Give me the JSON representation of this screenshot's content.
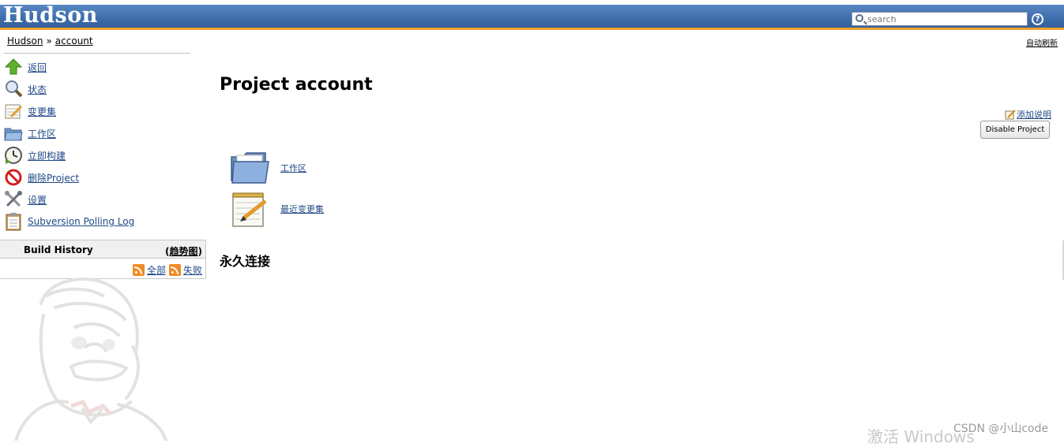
{
  "header": {
    "logo": "Hudson",
    "search_placeholder": "search",
    "help_icon": "?"
  },
  "breadcrumb": {
    "root": "Hudson",
    "separator": "»",
    "current": "account",
    "auto_refresh": "自动刷新"
  },
  "sidebar": {
    "tasks": [
      {
        "label": "返回",
        "icon": "up-arrow-icon"
      },
      {
        "label": "状态",
        "icon": "magnifier-icon"
      },
      {
        "label": "变更集",
        "icon": "notepad-icon"
      },
      {
        "label": "工作区",
        "icon": "folder-icon"
      },
      {
        "label": "立即构建",
        "icon": "clock-icon"
      },
      {
        "label": "删除Project",
        "icon": "no-entry-icon"
      },
      {
        "label": "设置",
        "icon": "tools-icon"
      },
      {
        "label": "Subversion Polling Log",
        "icon": "clipboard-icon"
      }
    ]
  },
  "build_history": {
    "title": "Build History",
    "trend_open": "(",
    "trend": "趋势图",
    "trend_close": ")",
    "feed_all": "全部",
    "feed_failed": "失败"
  },
  "main": {
    "title": "Project account",
    "add_description": "添加说明",
    "disable_button": "Disable Project",
    "links": [
      {
        "label": "工作区",
        "icon": "folder-icon"
      },
      {
        "label": "最近变更集",
        "icon": "notepad-icon"
      }
    ],
    "permalinks_heading": "永久连接"
  },
  "watermarks": {
    "windows": "激活 Windows",
    "csdn": "CSDN @小山code"
  },
  "colors": {
    "header_blue": "#3f6fae",
    "header_orange": "#f0a12f",
    "link": "#204a87"
  }
}
